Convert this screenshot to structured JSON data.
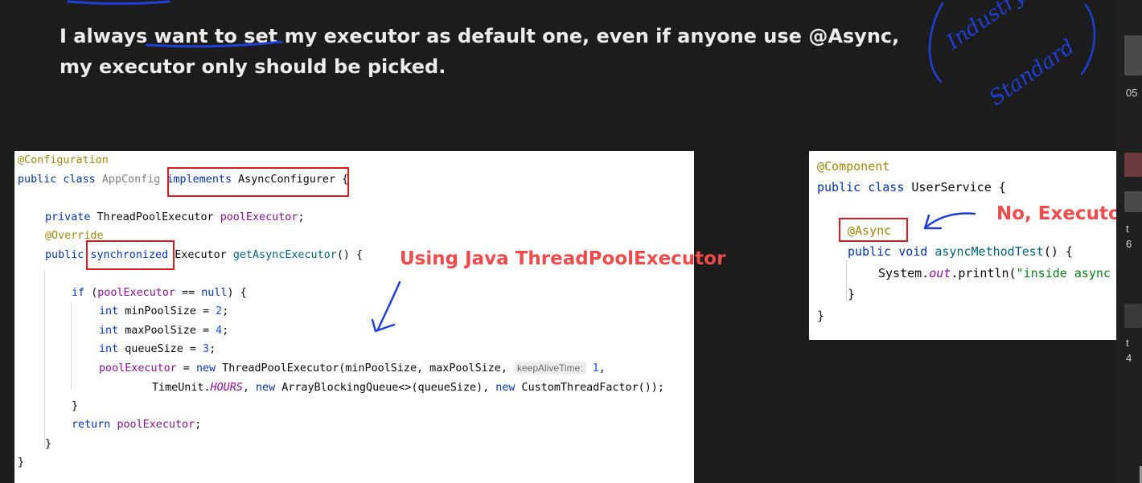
{
  "headline": "I always want to set my executor as default one, even if anyone use @Async, my executor only should be picked.",
  "left_code": {
    "l1": "@Configuration",
    "l2_kw": "public class ",
    "l2_cls": "AppConfig ",
    "l2_impl": "implements",
    "l2_iface": " AsyncConfigurer",
    "l2_end": " {",
    "l3_kw": "private ",
    "l3_type": "ThreadPoolExecutor ",
    "l3_field": "poolExecutor",
    "l3_end": ";",
    "l4": "@Override",
    "l5_kw": "public ",
    "l5_sync": "synchronized",
    "l5_rest": " Executor ",
    "l5_method": "getAsyncExecutor",
    "l5_end": "() {",
    "l6_kw": "if ",
    "l6_open": "(",
    "l6_field": "poolExecutor",
    "l6_op": " == ",
    "l6_null": "null",
    "l6_end": ") {",
    "l7_kw": "int ",
    "l7_name": "minPoolSize = ",
    "l7_num": "2",
    "l7_end": ";",
    "l8_kw": "int ",
    "l8_name": "maxPoolSize = ",
    "l8_num": "4",
    "l8_end": ";",
    "l9_kw": "int ",
    "l9_name": "queueSize = ",
    "l9_num": "3",
    "l9_end": ";",
    "l10_field": "poolExecutor",
    "l10_eq": " = ",
    "l10_new": "new",
    "l10_rest": " ThreadPoolExecutor(minPoolSize, maxPoolSize, ",
    "l10_hint": "keepAliveTime:",
    "l10_num": " 1",
    "l10_end": ",",
    "l11_a": "TimeUnit.",
    "l11_static": "HOURS",
    "l11_b": ", ",
    "l11_new1": "new",
    "l11_c": " ArrayBlockingQueue<>(queueSize), ",
    "l11_new2": "new",
    "l11_d": " CustomThreadFactor());",
    "l12": "}",
    "l13_kw": "return ",
    "l13_field": "poolExecutor",
    "l13_end": ";",
    "l14": "}",
    "l15": "}"
  },
  "right_code": {
    "r1": "@Component",
    "r2_kw": "public class ",
    "r2_rest": "UserService {",
    "r3": "@Async",
    "r4_kw": "public void ",
    "r4_method": "asyncMethodTest",
    "r4_end": "() {",
    "r5_a": "System.",
    "r5_static": "out",
    "r5_b": ".println(",
    "r5_str": "\"inside async",
    "r6": "}",
    "r7": "}"
  },
  "callouts": {
    "java_executor": "Using Java ThreadPoolExecutor",
    "no_executor": "No, Executor"
  },
  "handwriting": {
    "industry": "Industry",
    "standard": "Standard"
  },
  "right_strip": {
    "t1": "05",
    "t2": "t",
    "t3": "6",
    "t4": "t",
    "t5": "4"
  },
  "colors": {
    "background": "#1c1c1c",
    "box_red": "#e1191e",
    "callout_red": "#ef4a4c",
    "ink_blue": "#1f3fd6"
  }
}
